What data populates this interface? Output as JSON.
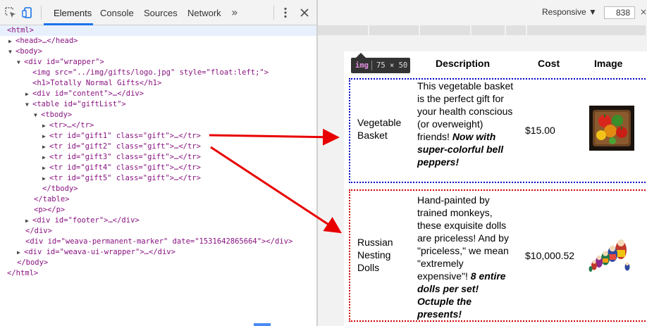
{
  "devtools": {
    "tabs": [
      "Elements",
      "Console",
      "Sources",
      "Network"
    ],
    "icons": {
      "inspect": "inspect-element-icon",
      "device": "device-toggle-icon",
      "more": "more-tabs-icon",
      "menu": "kebab-menu-icon",
      "close": "close-icon"
    },
    "dom": {
      "html_open": "<html>",
      "head": "<head>…</head>",
      "body_open": "<body>",
      "wrapper_open": "<div id=\"wrapper\">",
      "img_tag": "<img src=\"../img/gifts/logo.jpg\" style=\"float:left;\">",
      "h1": "<h1>Totally Normal Gifts</h1>",
      "content_div": "<div id=\"content\">…</div>",
      "table_open": "<table id=\"giftList\">",
      "tbody_open": "<tbody>",
      "tr_header": "<tr>…</tr>",
      "tr_gift1": "<tr id=\"gift1\" class=\"gift\">…</tr>",
      "tr_gift2": "<tr id=\"gift2\" class=\"gift\">…</tr>",
      "tr_gift3": "<tr id=\"gift3\" class=\"gift\">…</tr>",
      "tr_gift4": "<tr id=\"gift4\" class=\"gift\">…</tr>",
      "tr_gift5": "<tr id=\"gift5\" class=\"gift\">…</tr>",
      "tbody_close": "</tbody>",
      "table_close": "</table>",
      "p": "<p></p>",
      "footer_div": "<div id=\"footer\">…</div>",
      "div_close": "</div>",
      "marker_div": "<div id=\"weava-permanent-marker\" date=\"1531642865664\"></div>",
      "ui_wrapper_div": "<div id=\"weava-ui-wrapper\">…</div>",
      "body_close": "</body>",
      "html_close": "</html>"
    }
  },
  "device": {
    "mode": "Responsive",
    "width": "838",
    "tooltip": {
      "tag": "img",
      "size": "75 × 50"
    }
  },
  "page": {
    "headers": [
      "Description",
      "Cost",
      "Image"
    ],
    "gifts": [
      {
        "name": "Vegetable Basket",
        "description": "This vegetable basket is the perfect gift for your health conscious (or overweight) friends!",
        "emphasis": "Now with super-colorful bell peppers!",
        "cost": "$15.00",
        "image": "vegetable-basket-image",
        "outline_color": "#0000c8"
      },
      {
        "name": "Russian Nesting Dolls",
        "description": "Hand-painted by trained monkeys, these exquisite dolls are priceless! And by \"priceless,\" we mean \"extremely expensive\"!",
        "emphasis": "8 entire dolls per set! Octuple the presents!",
        "cost": "$10,000.52",
        "image": "nesting-dolls-image",
        "outline_color": "#d00000"
      }
    ]
  },
  "colors": {
    "arrow": "#e80000",
    "accent": "#1a73e8",
    "tag": "#881280",
    "attr_name": "#994500",
    "attr_value": "#1a1aa6"
  }
}
